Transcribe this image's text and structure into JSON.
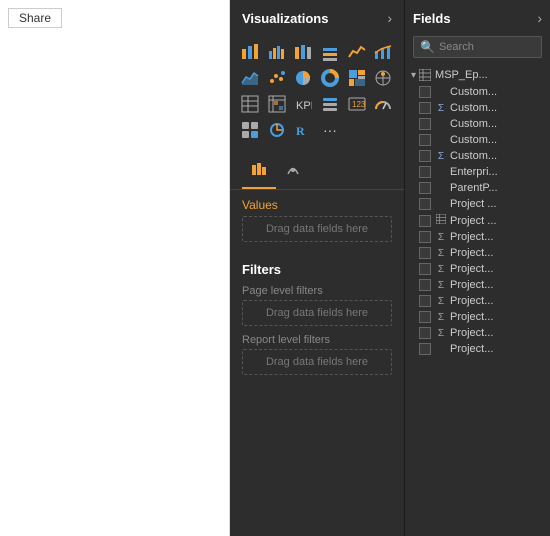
{
  "left_area": {
    "share_label": "Share"
  },
  "visualizations": {
    "title": "Visualizations",
    "expand_icon": "›",
    "tabs": [
      {
        "id": "chart",
        "label": "📊",
        "active": true
      },
      {
        "id": "format",
        "label": "🖊",
        "active": false
      }
    ],
    "values_label": "Values",
    "drag_label": "Drag data fields here",
    "filters": {
      "title": "Filters",
      "page_filters_label": "Page level filters",
      "page_drag_label": "Drag data fields here",
      "report_filters_label": "Report level filters",
      "report_drag_label": "Drag data fields here"
    }
  },
  "fields": {
    "title": "Fields",
    "expand_icon": "›",
    "search_placeholder": "Search",
    "parent_node": {
      "name": "MSP_Ep..."
    },
    "items": [
      {
        "id": 1,
        "name": "Custom...",
        "type": ""
      },
      {
        "id": 2,
        "name": "Custom...",
        "type": "sigma"
      },
      {
        "id": 3,
        "name": "Custom...",
        "type": ""
      },
      {
        "id": 4,
        "name": "Custom...",
        "type": ""
      },
      {
        "id": 5,
        "name": "Custom...",
        "type": "sigma"
      },
      {
        "id": 6,
        "name": "Enterpri...",
        "type": ""
      },
      {
        "id": 7,
        "name": "ParentP...",
        "type": ""
      },
      {
        "id": 8,
        "name": "Project ...",
        "type": ""
      },
      {
        "id": 9,
        "name": "Project ...",
        "type": "table"
      },
      {
        "id": 10,
        "name": "Project...",
        "type": "sigma"
      },
      {
        "id": 11,
        "name": "Project...",
        "type": "sigma"
      },
      {
        "id": 12,
        "name": "Project...",
        "type": "sigma"
      },
      {
        "id": 13,
        "name": "Project...",
        "type": "sigma"
      },
      {
        "id": 14,
        "name": "Project...",
        "type": "sigma"
      },
      {
        "id": 15,
        "name": "Project...",
        "type": "sigma"
      },
      {
        "id": 16,
        "name": "Project...",
        "type": "sigma"
      },
      {
        "id": 17,
        "name": "Project...",
        "type": ""
      }
    ]
  }
}
